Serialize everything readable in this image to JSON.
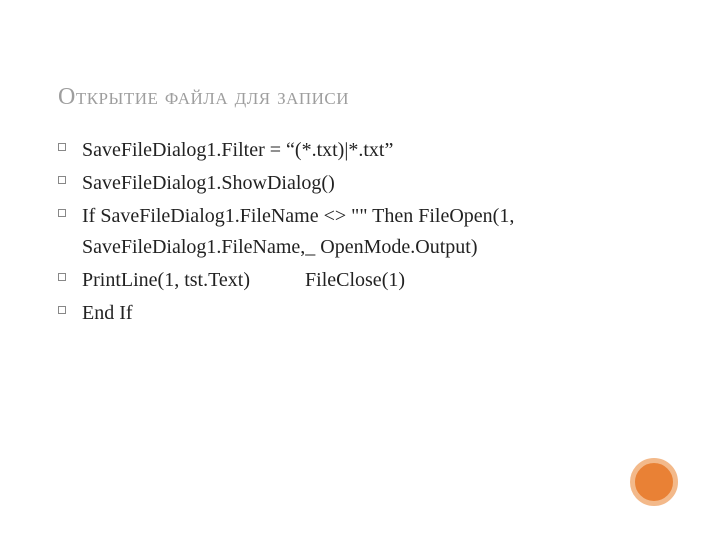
{
  "title": "Открытие файла для записи",
  "bullets": [
    " SaveFileDialog1.Filter = “(*.txt)|*.txt”",
    "SaveFileDialog1.ShowDialog()",
    "If SaveFileDialog1.FileName <> \"\" Then FileOpen(1, SaveFileDialog1.FileName,_ OpenMode.Output)",
    "  PrintLine(1, tst.Text)           FileClose(1)",
    "End If"
  ]
}
